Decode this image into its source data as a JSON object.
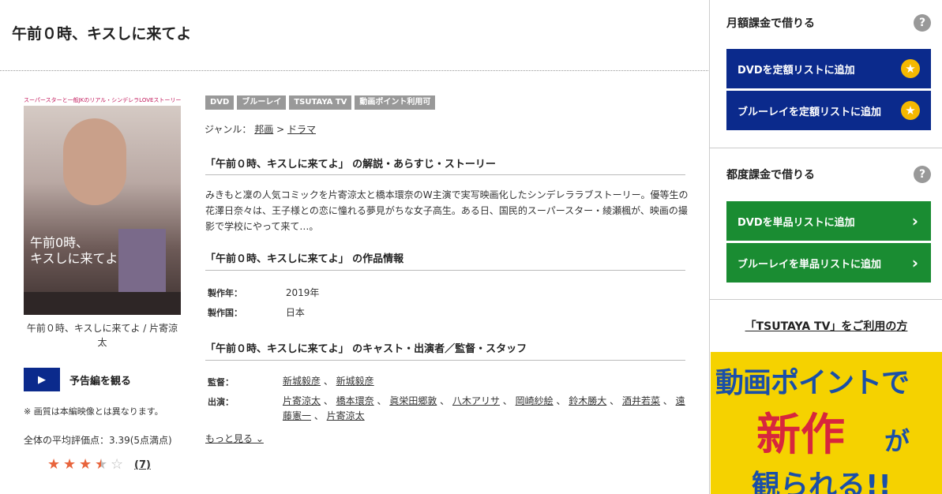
{
  "page": {
    "title": "午前０時、キスしに来てよ"
  },
  "poster": {
    "tagline": "スーパースターと一般JKのリアル・シンデレラLOVEストーリー",
    "title_art": "午前0時、\nキスしに来てよ",
    "caption": "午前０時、キスしに来てよ / 片寄涼太"
  },
  "trailer": {
    "label": "予告編を観る"
  },
  "note": "※ 画質は本編映像とは異なります。",
  "rating": {
    "average_text": "全体の平均評価点：3.39(5点満点)",
    "value": 3.39,
    "max": 5,
    "count": "(7)"
  },
  "tags": [
    "DVD",
    "ブルーレイ",
    "TSUTAYA TV",
    "動画ポイント利用可"
  ],
  "genre": {
    "label": "ジャンル：",
    "items": [
      "邦画",
      "ドラマ"
    ],
    "sep": ">"
  },
  "sections": {
    "story_title": "「午前０時、キスしに来てよ」 の解説・あらすじ・ストーリー",
    "story": "みきもと凜の人気コミックを片寄涼太と橋本環奈のW主演で実写映画化したシンデレララブストーリー。優等生の花澤日奈々は、王子様との恋に憧れる夢見がちな女子高生。ある日、国民的スーパースター・綾瀬楓が、映画の撮影で学校にやって来て…。",
    "info_title": "「午前０時、キスしに来てよ」 の作品情報",
    "info": [
      {
        "key": "製作年：",
        "value": "2019年"
      },
      {
        "key": "製作国：",
        "value": "日本"
      }
    ],
    "cast_title": "「午前０時、キスしに来てよ」 のキャスト・出演者／監督・スタッフ",
    "director_label": "監督：",
    "directors": [
      "新城毅彦",
      "新城毅彦"
    ],
    "cast_label": "出演：",
    "cast": [
      "片寄涼太",
      "橋本環奈",
      "眞栄田郷敦",
      "八木アリサ",
      "岡崎紗絵",
      "鈴木勝大",
      "酒井若菜",
      "遠藤憲一",
      "片寄涼太"
    ],
    "more": "もっと見る ⌄"
  },
  "sidebar": {
    "monthly_title": "月額課金で借りる",
    "monthly_buttons": [
      "DVDを定額リストに追加",
      "ブルーレイを定額リストに追加"
    ],
    "each_title": "都度課金で借りる",
    "each_buttons": [
      "DVDを単品リストに追加",
      "ブルーレイを単品リストに追加"
    ],
    "tv_link": "「TSUTAYA TV」をご利用の方",
    "banner": {
      "line1": "動画ポイントで",
      "line2": "新作",
      "line2b": "が",
      "line3": "観られる!!"
    }
  },
  "colors": {
    "blue": "#0b2a8c",
    "green": "#1a8c32",
    "star": "#e8643c",
    "banner": "#f5d200"
  }
}
